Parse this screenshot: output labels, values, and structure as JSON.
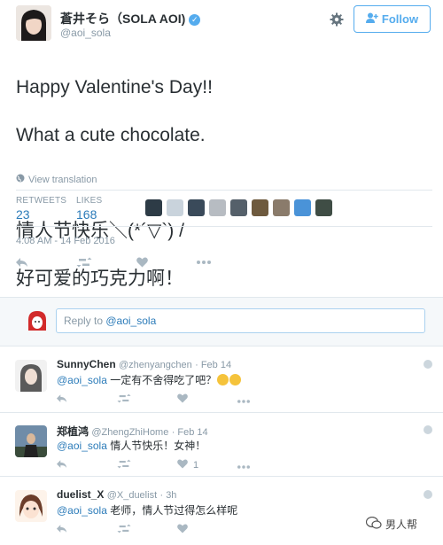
{
  "tweet": {
    "display_name": "蒼井そら（SOLA AOI)",
    "handle": "@aoi_sola",
    "follow_label": "Follow",
    "text_line1": "Happy Valentine's Day!!",
    "text_line2": "What a cute chocolate.",
    "text_line3": "情人节快乐＼(*´▽`) /",
    "text_line4": "好可爱的巧克力啊！",
    "view_translation": "View translation",
    "retweets_label": "RETWEETS",
    "retweets_count": "23",
    "likes_label": "LIKES",
    "likes_count": "168",
    "timestamp": "4:08 AM - 14 Feb 2016"
  },
  "reply_box": {
    "placeholder_prefix": "Reply to ",
    "placeholder_handle": "@aoi_sola"
  },
  "replies": [
    {
      "name": "SunnyChen",
      "handle": "@zhenyangchen",
      "time": "· Feb 14",
      "mention": "@aoi_sola",
      "text": " 一定有不舍得吃了吧？",
      "like_count": ""
    },
    {
      "name": "郑植鸿",
      "handle": "@ZhengZhiHome",
      "time": "· Feb 14",
      "mention": "@aoi_sola",
      "text": " 情人节快乐！女神！",
      "like_count": "1"
    },
    {
      "name": "duelist_X",
      "handle": "@X_duelist",
      "time": "· 3h",
      "mention": "@aoi_sola",
      "text": " 老师，情人节过得怎么样呢",
      "like_count": ""
    }
  ],
  "watermark": "男人帮",
  "colors": {
    "accent": "#55acee",
    "link": "#2b7bb9",
    "muted": "#8899a6",
    "icon": "#aab8c2",
    "border": "#e1e8ed"
  },
  "icons": {
    "verified": "verified-check-icon",
    "settings": "gear-icon",
    "follow": "add-user-icon",
    "reply": "reply-arrow-icon",
    "retweet": "retweet-icon",
    "like": "heart-icon",
    "more": "more-dots-icon",
    "globe": "globe-icon"
  }
}
